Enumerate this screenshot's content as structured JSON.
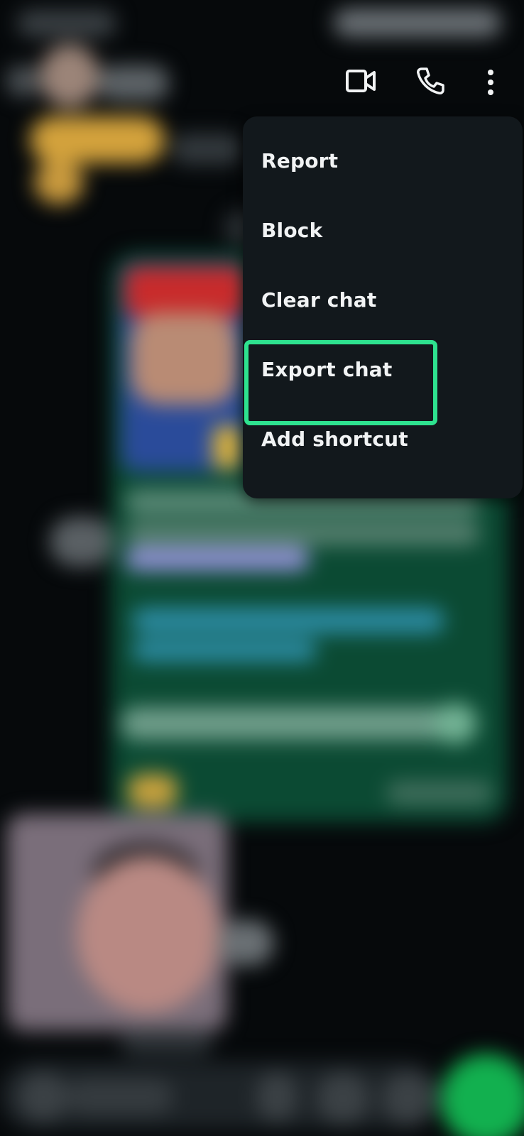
{
  "header": {
    "icons": [
      "video-call-icon",
      "voice-call-icon",
      "more-options-icon"
    ]
  },
  "menu": {
    "items": [
      {
        "label": "Report"
      },
      {
        "label": "Block"
      },
      {
        "label": "Clear chat"
      },
      {
        "label": "Export chat"
      },
      {
        "label": "Add shortcut"
      }
    ],
    "highlighted_item": "Export chat"
  },
  "colors": {
    "menu_bg": "#12181c",
    "highlight": "#2ee28f",
    "bubble": "#0b4a33",
    "mic_button": "#12b04f"
  }
}
